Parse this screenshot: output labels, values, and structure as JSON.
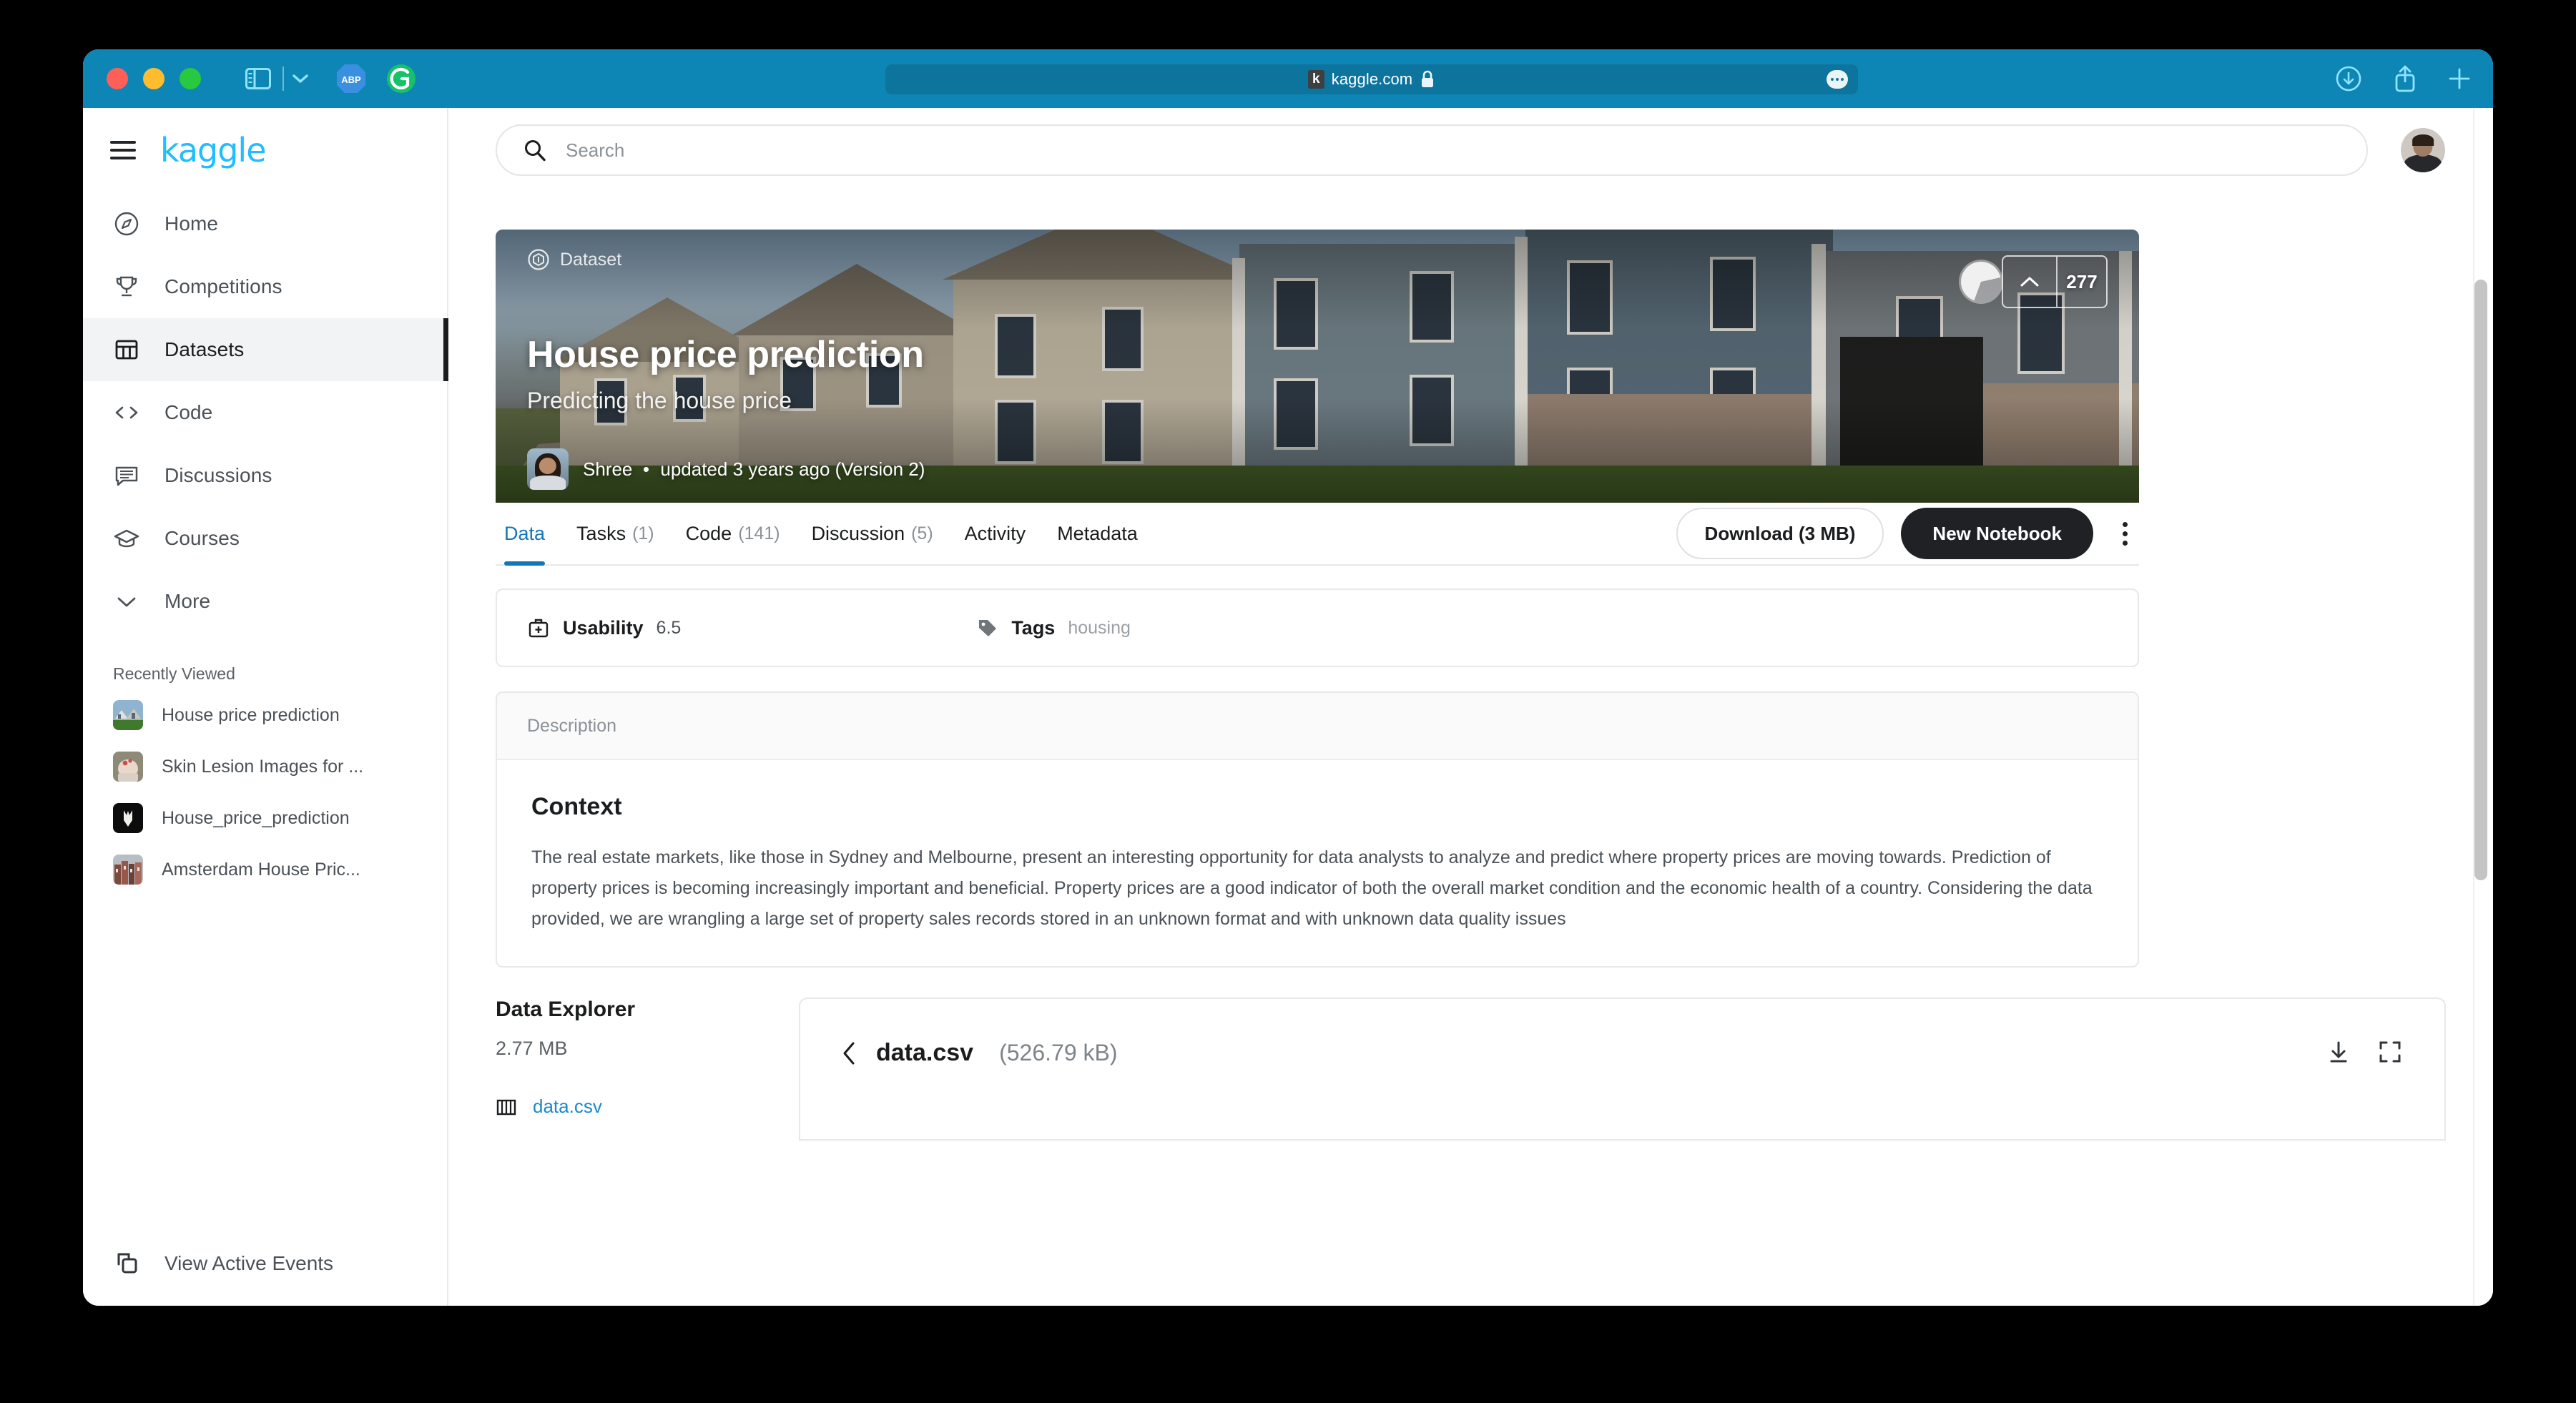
{
  "browser": {
    "url": "kaggle.com",
    "favicon_letter": "k",
    "lock_icon": "lock-icon",
    "traffic_lights": [
      "close",
      "minimize",
      "zoom"
    ],
    "extensions": [
      "ABP",
      "G"
    ],
    "toolbar_right_icons": [
      "downloads-icon",
      "share-icon",
      "new-tab-icon"
    ]
  },
  "sidebar": {
    "brand": "kaggle",
    "items": [
      {
        "label": "Home",
        "icon": "compass-icon",
        "active": false
      },
      {
        "label": "Competitions",
        "icon": "trophy-icon",
        "active": false
      },
      {
        "label": "Datasets",
        "icon": "table-icon",
        "active": true
      },
      {
        "label": "Code",
        "icon": "code-brackets-icon",
        "active": false
      },
      {
        "label": "Discussions",
        "icon": "comment-icon",
        "active": false
      },
      {
        "label": "Courses",
        "icon": "graduation-cap-icon",
        "active": false
      },
      {
        "label": "More",
        "icon": "chevron-down-icon",
        "active": false
      }
    ],
    "recently_viewed_header": "Recently Viewed",
    "recently_viewed": [
      {
        "label": "House price prediction"
      },
      {
        "label": "Skin Lesion Images for ..."
      },
      {
        "label": "House_price_prediction"
      },
      {
        "label": "Amsterdam House Pric..."
      }
    ],
    "events_label": "View Active Events"
  },
  "search": {
    "placeholder": "Search"
  },
  "hero": {
    "type_label": "Dataset",
    "title": "House price prediction",
    "subtitle": "Predicting the house price",
    "owner": "Shree",
    "updated": "updated 3 years ago (Version 2)",
    "vote_count": "277",
    "vote_icon": "upvote-chevron-icon"
  },
  "tabs": [
    {
      "label": "Data",
      "count": "",
      "active": true
    },
    {
      "label": "Tasks",
      "count": "(1)",
      "active": false
    },
    {
      "label": "Code",
      "count": "(141)",
      "active": false
    },
    {
      "label": "Discussion",
      "count": "(5)",
      "active": false
    },
    {
      "label": "Activity",
      "count": "",
      "active": false
    },
    {
      "label": "Metadata",
      "count": "",
      "active": false
    }
  ],
  "actions": {
    "download_label": "Download (3 MB)",
    "new_notebook_label": "New Notebook",
    "more_icon": "kebab-menu-icon"
  },
  "meta": {
    "usability_label": "Usability",
    "usability_value": "6.5",
    "usability_icon": "usability-icon",
    "tags_label": "Tags",
    "tags_icon": "tag-icon",
    "tags": [
      "housing"
    ]
  },
  "description": {
    "header": "Description",
    "heading": "Context",
    "body": "The real estate markets, like those in Sydney and Melbourne, present an interesting opportunity for data analysts to analyze and predict where property prices are moving towards. Prediction of property prices is becoming increasingly important and beneficial. Property prices are a good indicator of both the overall market condition and the economic health of a country. Considering the data provided, we are wrangling a large set of property sales records stored in an unknown format and with unknown data quality issues"
  },
  "data_explorer": {
    "title": "Data Explorer",
    "total_size": "2.77 MB",
    "file_link": "data.csv",
    "file_icon": "table-columns-icon",
    "selected_file_name": "data.csv",
    "selected_file_size": "(526.79 kB)",
    "back_icon": "chevron-left-icon",
    "download_icon": "download-icon",
    "fullscreen_icon": "fullscreen-icon"
  },
  "colors": {
    "accent_blue": "#20beff",
    "tab_active": "#1278b5",
    "chrome_blue": "#0e86b5",
    "dark_button": "#202124",
    "link_blue": "#1c89c9"
  }
}
